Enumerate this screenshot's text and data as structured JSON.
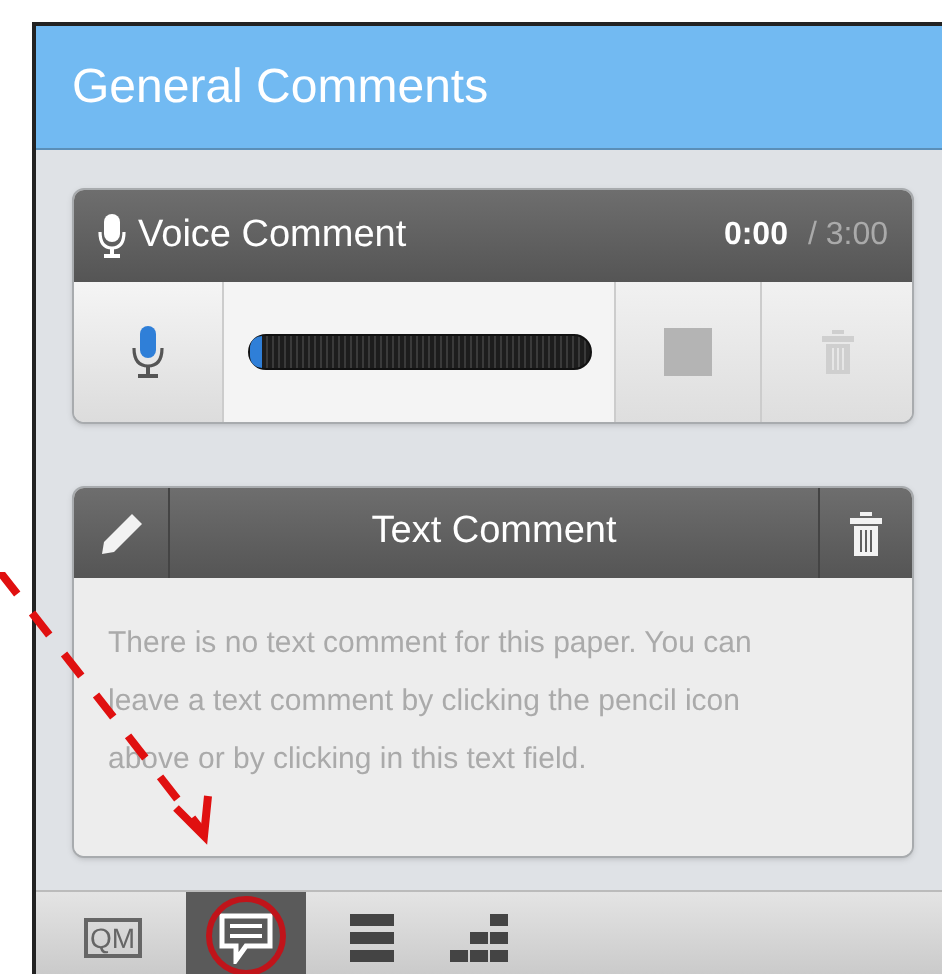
{
  "panel": {
    "title": "General Comments"
  },
  "voice_comment": {
    "title": "Voice Comment",
    "elapsed": "0:00",
    "total": "/ 3:00",
    "level": 0,
    "stop": {
      "disabled": true
    },
    "delete": {
      "disabled": true
    }
  },
  "text_comment": {
    "title": "Text Comment",
    "placeholder": "There is no text comment for this paper. You can leave a text comment by clicking the pencil icon above or by clicking in this text field."
  },
  "toolbar": [
    {
      "kind": "label",
      "label": "QM",
      "selected": false
    },
    {
      "kind": "comments",
      "selected": true
    },
    {
      "kind": "list",
      "selected": false
    },
    {
      "kind": "grid",
      "selected": false
    }
  ]
}
